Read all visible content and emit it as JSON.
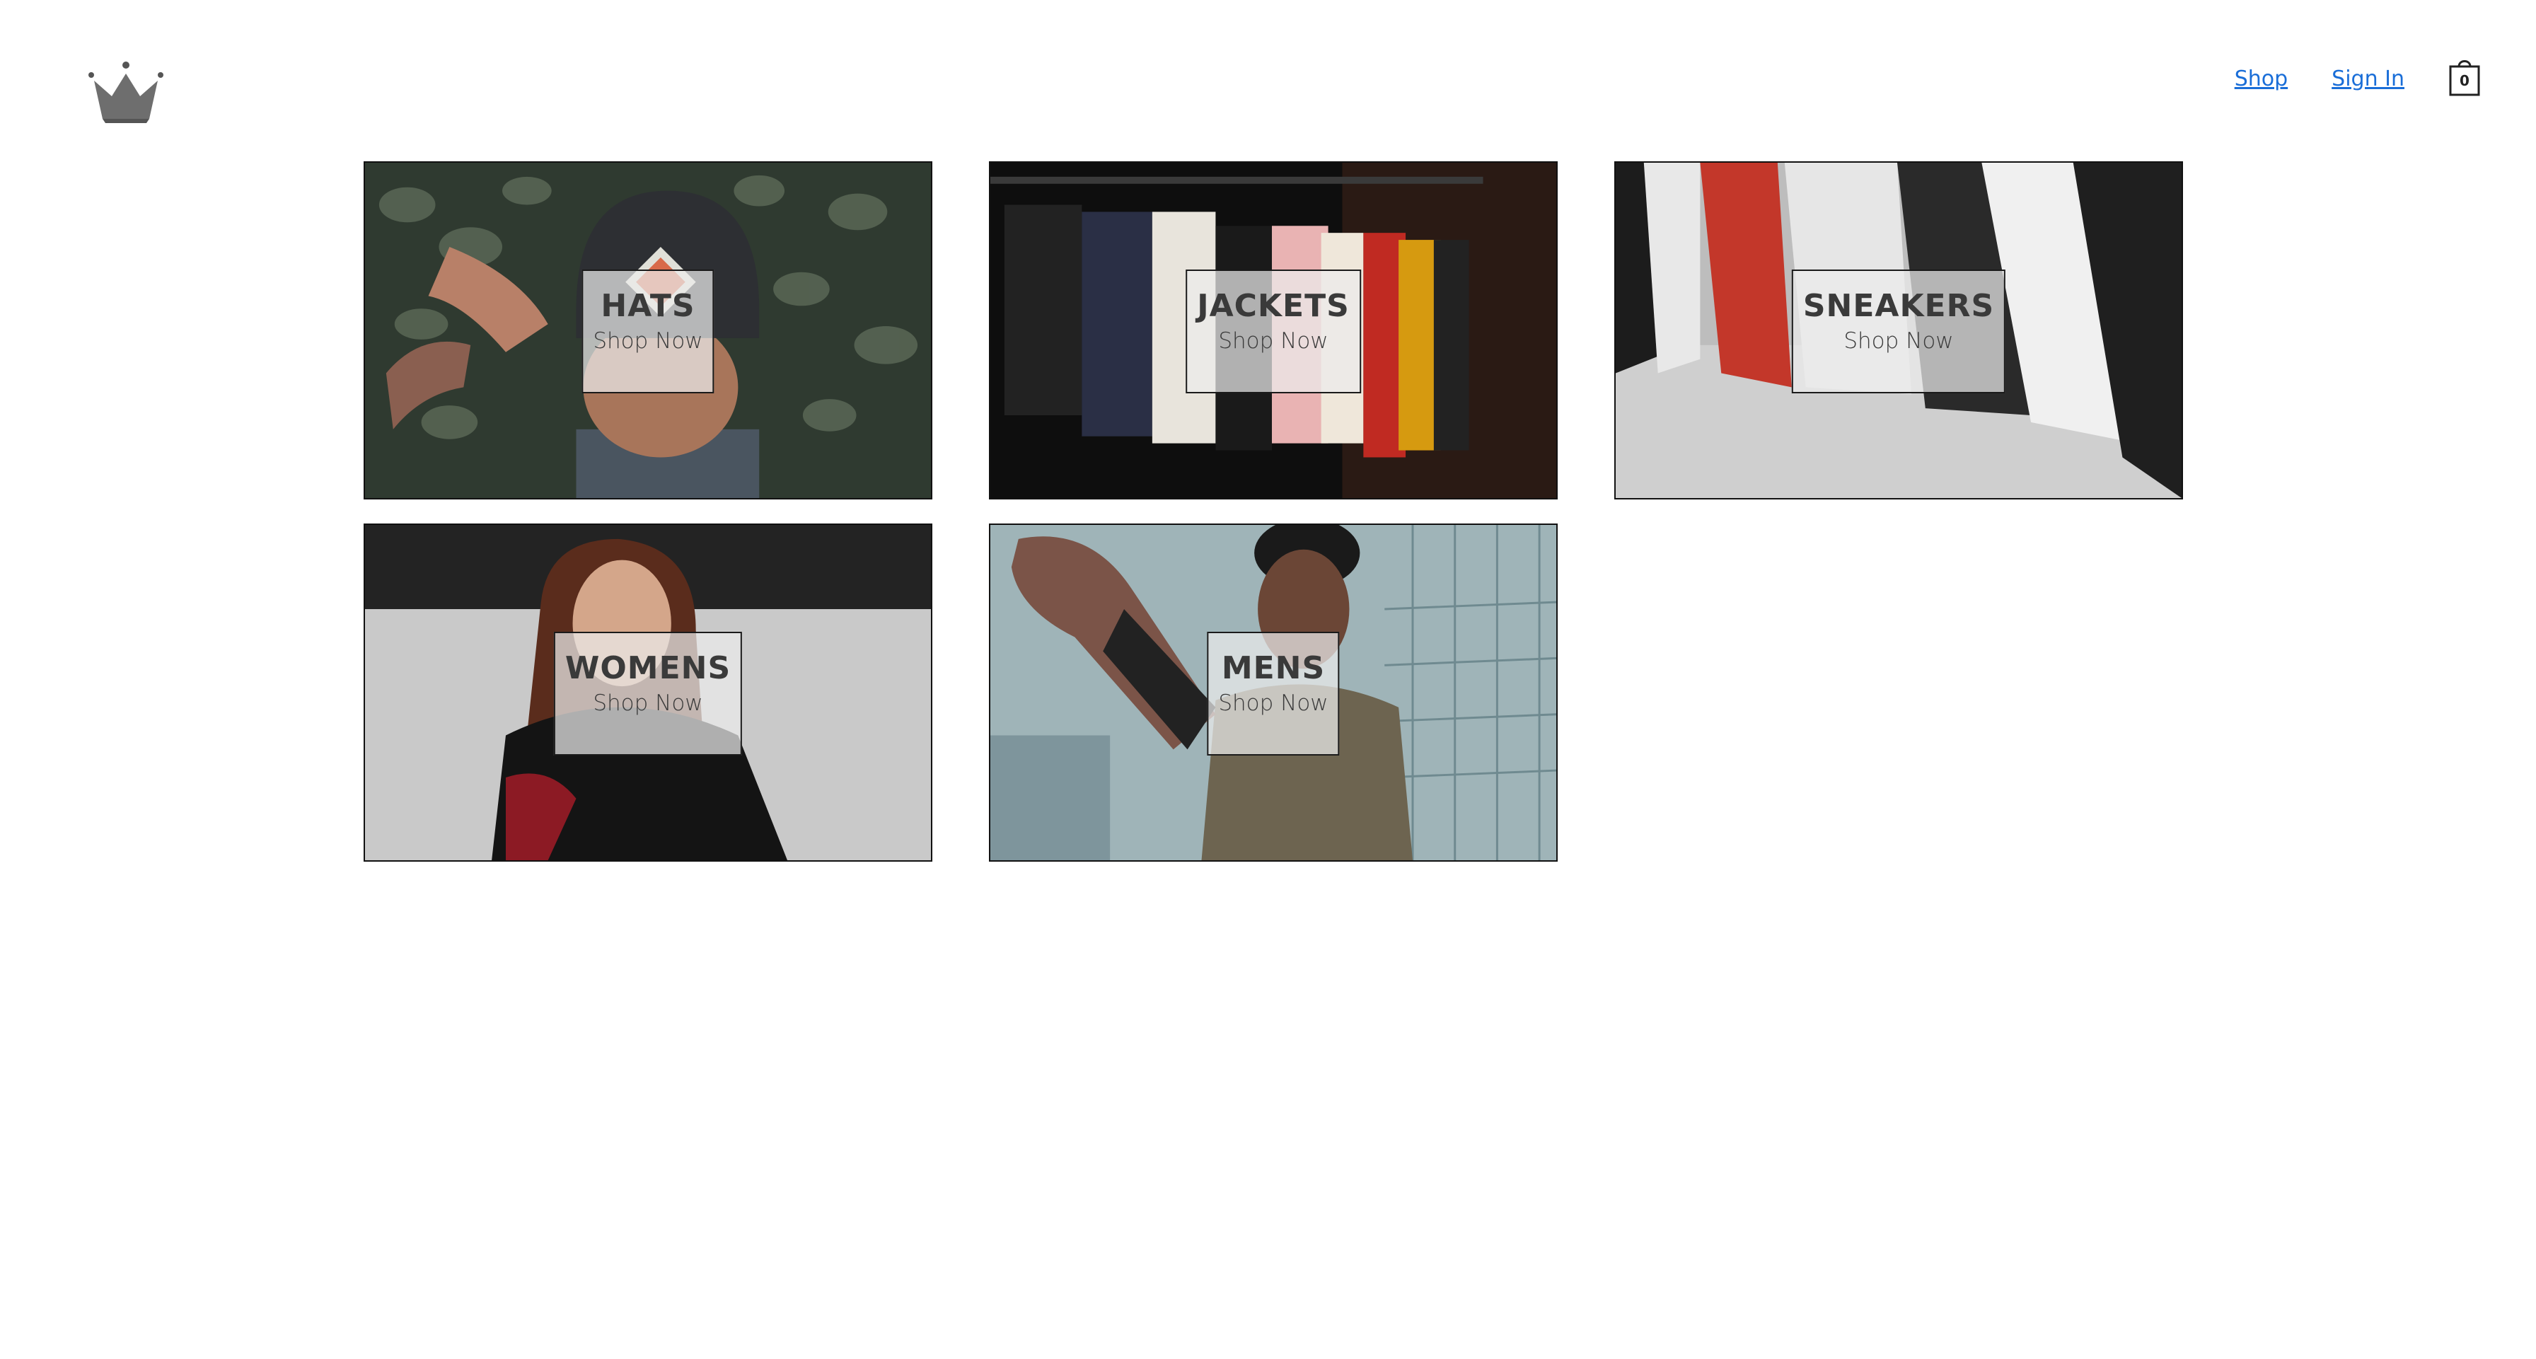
{
  "header": {
    "logo_icon": "crown-icon",
    "nav": {
      "shop_label": "Shop",
      "signin_label": "Sign In"
    },
    "cart": {
      "icon": "shopping-bag-icon",
      "count": "0"
    },
    "link_color": "#1a6ed8"
  },
  "directory": {
    "items": [
      {
        "title": "HATS",
        "subtitle": "Shop Now"
      },
      {
        "title": "JACKETS",
        "subtitle": "Shop Now"
      },
      {
        "title": "SNEAKERS",
        "subtitle": "Shop Now"
      },
      {
        "title": "WOMENS",
        "subtitle": "Shop Now"
      },
      {
        "title": "MENS",
        "subtitle": "Shop Now"
      }
    ]
  }
}
